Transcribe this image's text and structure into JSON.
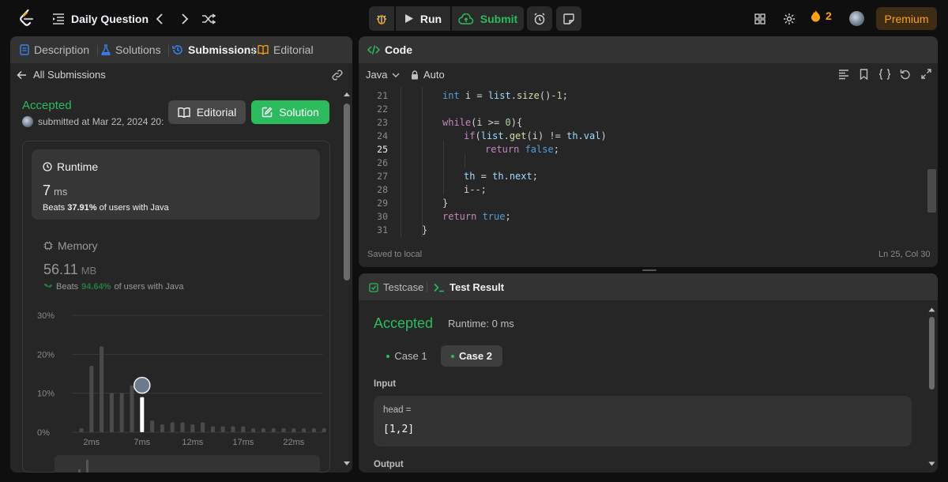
{
  "topbar": {
    "title": "Daily Question",
    "run_label": "Run",
    "submit_label": "Submit",
    "streak_count": "2",
    "premium_label": "Premium"
  },
  "left_tabs": [
    {
      "label": "Description"
    },
    {
      "label": "Solutions"
    },
    {
      "label": "Submissions"
    },
    {
      "label": "Editorial"
    }
  ],
  "submissions": {
    "back_label": "All Submissions",
    "status": "Accepted",
    "submitted_text": "submitted at Mar 22, 2024 20:",
    "editorial_button": "Editorial",
    "solution_button": "Solution",
    "runtime": {
      "title": "Runtime",
      "value": "7",
      "unit": "ms",
      "beats_prefix": "Beats",
      "beats_pct": "37.91%",
      "beats_suffix": "of users with Java"
    },
    "memory": {
      "title": "Memory",
      "value": "56.11",
      "unit": "MB",
      "beats_prefix": "Beats",
      "beats_pct": "94.64%",
      "beats_suffix": "of users with Java"
    }
  },
  "chart_data": {
    "type": "bar",
    "yticks": [
      "30%",
      "20%",
      "10%",
      "0%"
    ],
    "ylim": [
      0,
      30
    ],
    "xticks": [
      "2ms",
      "7ms",
      "12ms",
      "17ms",
      "22ms"
    ],
    "categories_ms": [
      1,
      2,
      3,
      4,
      5,
      6,
      7,
      8,
      9,
      10,
      11,
      12,
      13,
      14,
      15,
      16,
      17,
      18,
      19,
      20,
      21,
      22,
      23,
      24,
      25
    ],
    "values": [
      1,
      17,
      22,
      10,
      10,
      12,
      9,
      3,
      2,
      2.5,
      2.5,
      2,
      2.5,
      1.5,
      1.5,
      1.5,
      1.5,
      1,
      1,
      1,
      1,
      1,
      1,
      1,
      1
    ],
    "highlight_category_ms": 7,
    "colors": {
      "bar": "#4a4a4a",
      "highlight": "#ffffff",
      "grid": "#3a3a3a"
    }
  },
  "code_panel": {
    "title": "Code",
    "language": "Java",
    "mode": "Auto",
    "status_left": "Saved to local",
    "status_right": "Ln 25, Col 30",
    "lines": [
      {
        "n": "21",
        "indent": 2,
        "tokens": [
          [
            "int",
            "kw2"
          ],
          [
            " i = ",
            ""
          ],
          [
            "list",
            "id"
          ],
          [
            ".",
            ""
          ],
          [
            "size",
            "fn"
          ],
          [
            "()-",
            ""
          ],
          [
            "1",
            "num"
          ],
          [
            ";",
            ""
          ]
        ]
      },
      {
        "n": "22",
        "indent": 0,
        "tokens": []
      },
      {
        "n": "23",
        "indent": 2,
        "tokens": [
          [
            "while",
            "kw"
          ],
          [
            "(i >= ",
            ""
          ],
          [
            "0",
            "num"
          ],
          [
            "){",
            ""
          ]
        ]
      },
      {
        "n": "24",
        "indent": 3,
        "tokens": [
          [
            "if",
            "kw"
          ],
          [
            "(",
            ""
          ],
          [
            "list",
            "id"
          ],
          [
            ".",
            ""
          ],
          [
            "get",
            "fn"
          ],
          [
            "(i) != ",
            ""
          ],
          [
            "th",
            "id"
          ],
          [
            ".",
            ""
          ],
          [
            "val",
            "id"
          ],
          [
            ")",
            ""
          ]
        ]
      },
      {
        "n": "25",
        "indent": 4,
        "tokens": [
          [
            "return ",
            "kw"
          ],
          [
            "false",
            "kw2"
          ],
          [
            ";",
            ""
          ]
        ],
        "current": true
      },
      {
        "n": "26",
        "indent": 0,
        "tokens": []
      },
      {
        "n": "27",
        "indent": 3,
        "tokens": [
          [
            "th",
            "id"
          ],
          [
            " = ",
            ""
          ],
          [
            "th",
            "id"
          ],
          [
            ".",
            ""
          ],
          [
            "next",
            "id"
          ],
          [
            ";",
            ""
          ]
        ]
      },
      {
        "n": "28",
        "indent": 3,
        "tokens": [
          [
            "i--;",
            ""
          ]
        ]
      },
      {
        "n": "29",
        "indent": 2,
        "tokens": [
          [
            "}",
            ""
          ]
        ]
      },
      {
        "n": "30",
        "indent": 2,
        "tokens": [
          [
            "return ",
            "kw"
          ],
          [
            "true",
            "kw2"
          ],
          [
            ";",
            ""
          ]
        ]
      },
      {
        "n": "31",
        "indent": 1,
        "tokens": [
          [
            "}",
            ""
          ]
        ]
      }
    ]
  },
  "result_panel": {
    "tab_testcase": "Testcase",
    "tab_result": "Test Result",
    "status": "Accepted",
    "runtime_text": "Runtime: 0 ms",
    "case1": "Case 1",
    "case2": "Case 2",
    "input_label": "Input",
    "var_name": "head =",
    "var_value": "[1,2]",
    "output_label": "Output"
  }
}
